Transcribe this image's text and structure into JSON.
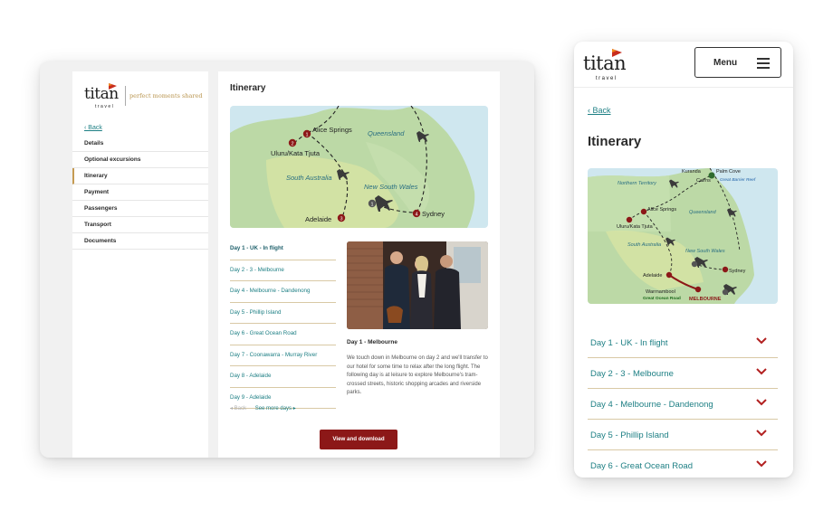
{
  "brand": {
    "logo_word": "titan",
    "logo_sub": "travel",
    "tagline": "perfect moments shared",
    "accent": "#8c1818",
    "link_color": "#1d7f84",
    "gold": "#c59b53"
  },
  "tablet": {
    "sidebar": {
      "back": "‹ Back",
      "items": [
        {
          "label": "Details"
        },
        {
          "label": "Optional excursions"
        },
        {
          "label": "Itinerary",
          "active": true
        },
        {
          "label": "Payment"
        },
        {
          "label": "Passengers"
        },
        {
          "label": "Transport"
        },
        {
          "label": "Documents"
        }
      ]
    },
    "main": {
      "title": "Itinerary",
      "map_labels": {
        "alice_springs": "Alice Springs",
        "queensland": "Queensland",
        "uluru": "Uluru/Kata Tjuta",
        "south_australia": "South Australia",
        "nsw": "New South Wales",
        "adelaide": "Adelaide",
        "sydney": "Sydney",
        "stop_numbers": [
          "1",
          "2",
          "3",
          "4"
        ]
      },
      "days": [
        "Day 1 - UK - In flight",
        "Day 2 - 3 - Melbourne",
        "Day 4 -  Melbourne - Dandenong",
        "Day 5 - Phillip Island",
        "Day 6 - Great Ocean Road",
        "Day 7 - Coonawarra - Murray River",
        "Day 8 - Adelaide",
        "Day 9 - Adelaide"
      ],
      "pager_back": "◂ Back",
      "pager_more": "See more days ▸",
      "detail_title": "Day 1 - Melbourne",
      "detail_text": "We touch down in Melbourne on day 2 and we'll transfer to our hotel for some time to relax after the long flight. The following day is at leisure to explore Melbourne's tram-crossed streets, historic shopping arcades and riverside parks.",
      "download_button": "View and download"
    }
  },
  "phone": {
    "menu": "Menu",
    "back": "‹ Back",
    "title": "Itinerary",
    "map_labels": {
      "kuranda": "Kuranda",
      "palm_cove": "Palm Cove",
      "cairns": "Cairns",
      "great_barrier_reef": "Great Barrier Reef",
      "northern_territory": "Northern Territory",
      "alice_springs": "Alice Springs",
      "queensland": "Queensland",
      "uluru": "Uluru/Kata Tjuta",
      "south_australia": "South Australia",
      "nsw": "New South Wales",
      "adelaide": "Adelaide",
      "sydney": "Sydney",
      "warrnambool": "Warrnambool",
      "great_ocean_road": "Great Ocean Road",
      "melbourne": "MELBOURNE"
    },
    "days": [
      "Day 1 - UK - In flight",
      "Day 2 - 3 - Melbourne",
      "Day 4 -  Melbourne - Dandenong",
      "Day 5 - Phillip Island",
      "Day 6 - Great Ocean Road"
    ]
  }
}
